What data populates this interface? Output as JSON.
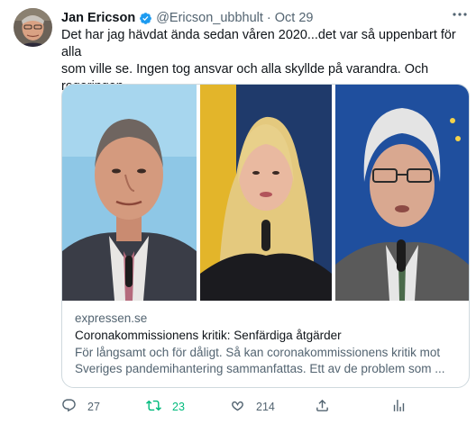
{
  "author": {
    "name": "Jan Ericson",
    "handle": "@Ericson_ubbhult",
    "separator": "·",
    "time": "Oct 29",
    "verified": true
  },
  "tweet_text": "Det har jag hävdat ända sedan våren 2020...det var så uppenbart för alla\nsom ville se. Ingen tog ansvar och alla skyllde på varandra. Och regeringen\nsov. Hur många liv kostade detta?",
  "card": {
    "domain": "expressen.se",
    "title": "Coronakommissionens kritik: Senfärdiga åtgärder",
    "description": "För långsamt och för dåligt. Så kan coronakommissionens kritik mot\nSveriges pandemihantering sammanfattas. Ett av de problem som ..."
  },
  "actions": {
    "reply_count": "27",
    "retweet_count": "23",
    "like_count": "214"
  },
  "icons": {
    "more": "more-dots-icon",
    "verified": "verified-badge-icon",
    "reply": "reply-icon",
    "retweet": "retweet-icon",
    "like": "heart-icon",
    "share": "share-icon",
    "stats": "analytics-icon"
  },
  "colors": {
    "accent": "#1d9bf0",
    "retweeted": "#00ba7c",
    "secondary_text": "#536471",
    "border": "#cfd9de"
  }
}
